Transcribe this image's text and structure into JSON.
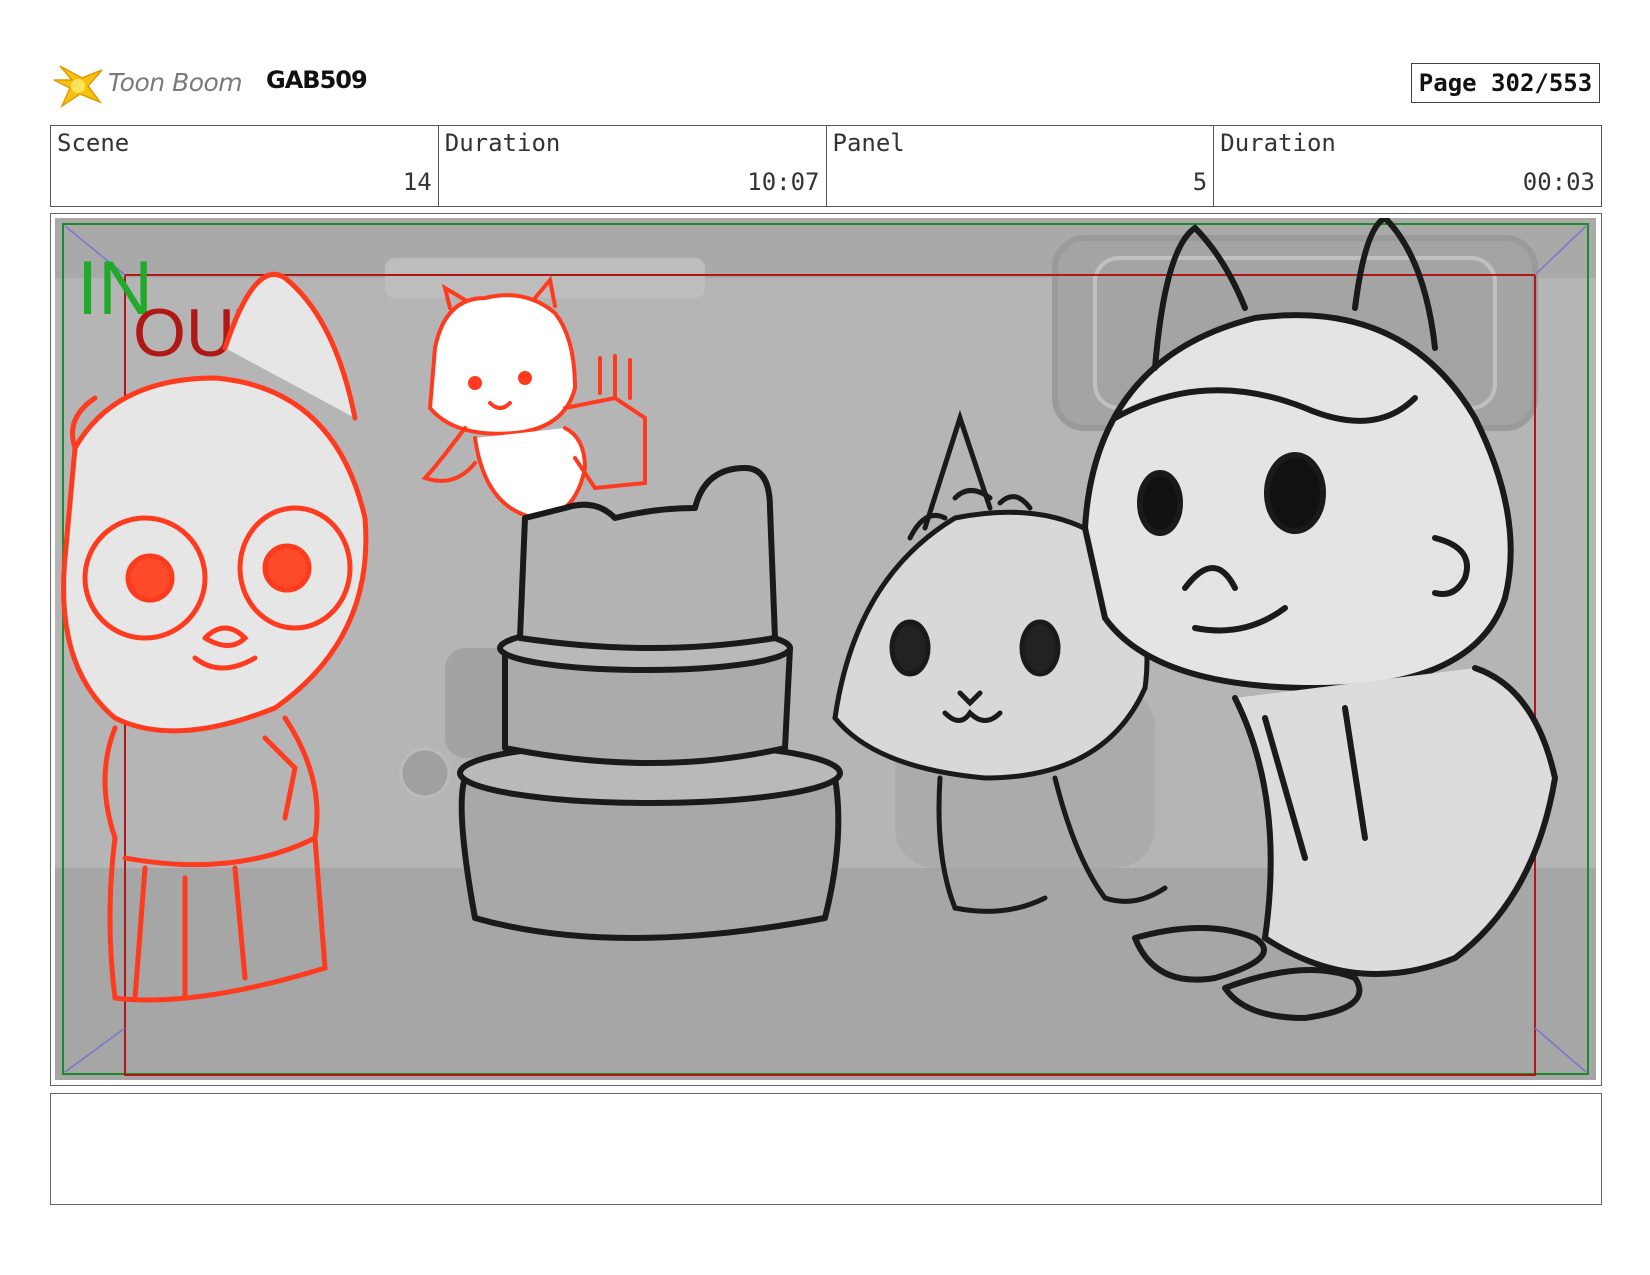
{
  "header": {
    "logo_text": "Toon Boom",
    "project_code": "GAB509",
    "page_label": "Page 302/553"
  },
  "info": {
    "scene_label": "Scene",
    "scene_value": "14",
    "scene_duration_label": "Duration",
    "scene_duration_value": "10:07",
    "panel_label": "Panel",
    "panel_value": "5",
    "panel_duration_label": "Duration",
    "panel_duration_value": "00:03"
  },
  "panel": {
    "in_marker": "IN",
    "out_marker": "OUT",
    "colors": {
      "in_frame": "#1f8a2a",
      "out_frame": "#b01818",
      "red_sketch": "#ff3b1f",
      "line_art": "#1a1a1a",
      "background": "#b5b5b5"
    }
  },
  "notes": {
    "text": ""
  }
}
